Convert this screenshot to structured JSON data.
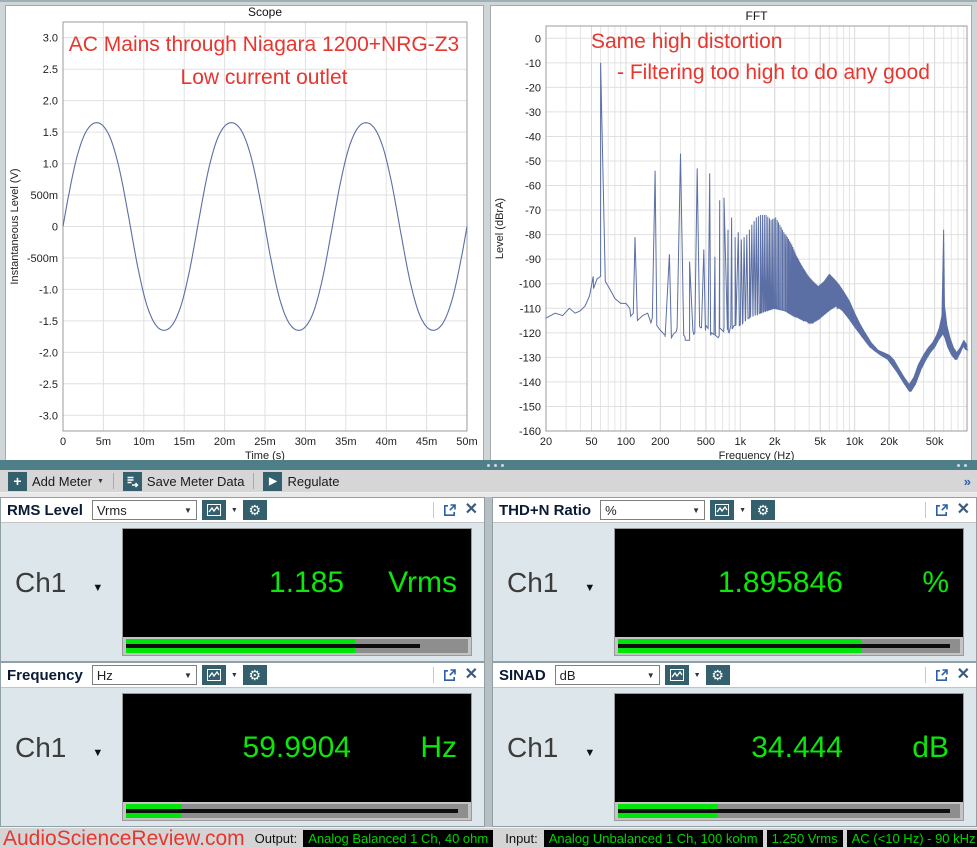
{
  "colors": {
    "accent_teal": "#34606e",
    "splitter_teal": "#4e7e88",
    "trace_blue": "#5b6fa5",
    "annotation_red": "#e8352e",
    "meter_green": "#0ce60c",
    "bar_green": "#00e40c",
    "badge_green": "#00d400",
    "icon_blue": "#2c5eaa"
  },
  "toolbar": {
    "add_meter": "Add Meter",
    "save_meter_data": "Save Meter Data",
    "regulate": "Regulate"
  },
  "meters": [
    {
      "name": "RMS Level",
      "unit_selector": "Vrms",
      "channel": "Ch1",
      "value": "1.185",
      "unit": "Vrms",
      "bar_fill": 0.67,
      "bar_peak": 0.86
    },
    {
      "name": "THD+N Ratio",
      "unit_selector": "%",
      "channel": "Ch1",
      "value": "1.895846",
      "unit": "%",
      "bar_fill": 0.71,
      "bar_peak": 0.97
    },
    {
      "name": "Frequency",
      "unit_selector": "Hz",
      "channel": "Ch1",
      "value": "59.9904",
      "unit": "Hz",
      "bar_fill": 0.16,
      "bar_peak": 0.97
    },
    {
      "name": "SINAD",
      "unit_selector": "dB",
      "channel": "Ch1",
      "value": "34.444",
      "unit": "dB",
      "bar_fill": 0.29,
      "bar_peak": 0.97
    }
  ],
  "status": {
    "watermark": "AudioScienceReview.com",
    "output_label": "Output:",
    "output_value": "Analog Balanced 1 Ch, 40 ohm",
    "input_label": "Input:",
    "input_badges": [
      "Analog Unbalanced 1 Ch, 100 kohm",
      "1.250 Vrms",
      "AC (<10 Hz) - 90 kHz"
    ]
  },
  "chart_data": [
    {
      "type": "line",
      "id": "scope",
      "title": "Scope",
      "xlabel": "Time (s)",
      "ylabel": "Instantaneous Level (V)",
      "xlim": [
        0,
        0.05
      ],
      "ylim": [
        -3.25,
        3.25
      ],
      "grid": true,
      "x_ticks": [
        {
          "v": 0,
          "label": "0"
        },
        {
          "v": 0.005,
          "label": "5m"
        },
        {
          "v": 0.01,
          "label": "10m"
        },
        {
          "v": 0.015,
          "label": "15m"
        },
        {
          "v": 0.02,
          "label": "20m"
        },
        {
          "v": 0.025,
          "label": "25m"
        },
        {
          "v": 0.03,
          "label": "30m"
        },
        {
          "v": 0.035,
          "label": "35m"
        },
        {
          "v": 0.04,
          "label": "40m"
        },
        {
          "v": 0.045,
          "label": "45m"
        },
        {
          "v": 0.05,
          "label": "50m"
        }
      ],
      "y_ticks": [
        {
          "v": 3,
          "label": "3.0"
        },
        {
          "v": 2.5,
          "label": "2.5"
        },
        {
          "v": 2,
          "label": "2.0"
        },
        {
          "v": 1.5,
          "label": "1.5"
        },
        {
          "v": 1,
          "label": "1.0"
        },
        {
          "v": 0.5,
          "label": "500m"
        },
        {
          "v": 0,
          "label": "0"
        },
        {
          "v": -0.5,
          "label": "-500m"
        },
        {
          "v": -1,
          "label": "-1.0"
        },
        {
          "v": -1.5,
          "label": "-1.5"
        },
        {
          "v": -2,
          "label": "-2.0"
        },
        {
          "v": -2.5,
          "label": "-2.5"
        },
        {
          "v": -3,
          "label": "-3.0"
        }
      ],
      "signal": {
        "shape": "ac-mains-sine",
        "frequency_hz": 60,
        "amplitude_v": 1.65,
        "duration_s": 0.05,
        "cycles": 3,
        "flat_top_3rd_harmonic": 0.04
      },
      "annotations": [
        {
          "text": "AC Mains through Niagara 1200+NRG-Z3",
          "x": 258,
          "y": 45,
          "anchor": "middle"
        },
        {
          "text": "Low current outlet",
          "x": 258,
          "y": 78,
          "anchor": "middle"
        }
      ]
    },
    {
      "type": "line",
      "id": "fft",
      "title": "FFT",
      "xlabel": "Frequency (Hz)",
      "ylabel": "Level (dBrA)",
      "xscale": "log",
      "xlim": [
        20,
        96000
      ],
      "ylim": [
        -160,
        5
      ],
      "grid": true,
      "x_ticks": [
        {
          "v": 20,
          "label": "20"
        },
        {
          "v": 50,
          "label": "50"
        },
        {
          "v": 100,
          "label": "100"
        },
        {
          "v": 200,
          "label": "200"
        },
        {
          "v": 500,
          "label": "500"
        },
        {
          "v": 1000,
          "label": "1k"
        },
        {
          "v": 2000,
          "label": "2k"
        },
        {
          "v": 5000,
          "label": "5k"
        },
        {
          "v": 10000,
          "label": "10k"
        },
        {
          "v": 20000,
          "label": "20k"
        },
        {
          "v": 50000,
          "label": "50k"
        }
      ],
      "y_ticks": [
        {
          "v": 0,
          "label": "0"
        },
        {
          "v": -10,
          "label": "-10"
        },
        {
          "v": -20,
          "label": "-20"
        },
        {
          "v": -30,
          "label": "-30"
        },
        {
          "v": -40,
          "label": "-40"
        },
        {
          "v": -50,
          "label": "-50"
        },
        {
          "v": -60,
          "label": "-60"
        },
        {
          "v": -70,
          "label": "-70"
        },
        {
          "v": -80,
          "label": "-80"
        },
        {
          "v": -90,
          "label": "-90"
        },
        {
          "v": -100,
          "label": "-100"
        },
        {
          "v": -110,
          "label": "-110"
        },
        {
          "v": -120,
          "label": "-120"
        },
        {
          "v": -130,
          "label": "-130"
        },
        {
          "v": -140,
          "label": "-140"
        },
        {
          "v": -150,
          "label": "-150"
        },
        {
          "v": -160,
          "label": "-160"
        }
      ],
      "floor": [
        [
          20,
          -114
        ],
        [
          24,
          -112
        ],
        [
          28,
          -113
        ],
        [
          32,
          -110
        ],
        [
          36,
          -112
        ],
        [
          40,
          -111
        ],
        [
          44,
          -109
        ],
        [
          48,
          -105
        ],
        [
          52,
          -102
        ],
        [
          56,
          -98
        ],
        [
          60,
          -97
        ],
        [
          66,
          -99
        ],
        [
          72,
          -102
        ],
        [
          80,
          -106
        ],
        [
          90,
          -108
        ],
        [
          100,
          -108
        ],
        [
          108,
          -110
        ],
        [
          116,
          -112
        ],
        [
          126,
          -115
        ],
        [
          140,
          -113
        ],
        [
          155,
          -112
        ],
        [
          170,
          -114
        ],
        [
          186,
          -117
        ],
        [
          200,
          -119
        ],
        [
          220,
          -121
        ],
        [
          250,
          -122
        ],
        [
          280,
          -118
        ],
        [
          320,
          -121
        ],
        [
          360,
          -123
        ],
        [
          400,
          -120
        ],
        [
          450,
          -118
        ],
        [
          500,
          -117
        ],
        [
          560,
          -120
        ],
        [
          640,
          -122
        ],
        [
          720,
          -118
        ],
        [
          800,
          -120
        ],
        [
          900,
          -117
        ],
        [
          1000,
          -117
        ],
        [
          1200,
          -114
        ],
        [
          1500,
          -112
        ],
        [
          2000,
          -110
        ],
        [
          2500,
          -111
        ],
        [
          3000,
          -113
        ],
        [
          3600,
          -115
        ],
        [
          4200,
          -116
        ],
        [
          5000,
          -114
        ],
        [
          6000,
          -111
        ],
        [
          7000,
          -109
        ],
        [
          8000,
          -111
        ],
        [
          9000,
          -114
        ],
        [
          10000,
          -117
        ],
        [
          12000,
          -122
        ],
        [
          14000,
          -126
        ],
        [
          17000,
          -129
        ],
        [
          20000,
          -131
        ],
        [
          24000,
          -136
        ],
        [
          28000,
          -141
        ],
        [
          31000,
          -144
        ],
        [
          34000,
          -141
        ],
        [
          38000,
          -135
        ],
        [
          42000,
          -131
        ],
        [
          46000,
          -128
        ],
        [
          50000,
          -126
        ],
        [
          54000,
          -123
        ],
        [
          58000,
          -121
        ],
        [
          60000,
          -120
        ],
        [
          63000,
          -122
        ],
        [
          67000,
          -126
        ],
        [
          72000,
          -129
        ],
        [
          78000,
          -131
        ],
        [
          84000,
          -128
        ],
        [
          90000,
          -125
        ],
        [
          96000,
          -127
        ]
      ],
      "harmonics": [
        [
          60,
          -10
        ],
        [
          120,
          -81
        ],
        [
          180,
          -54
        ],
        [
          240,
          -88
        ],
        [
          300,
          -47
        ],
        [
          360,
          -91
        ],
        [
          420,
          -53
        ],
        [
          480,
          -86
        ],
        [
          540,
          -55
        ],
        [
          600,
          -89
        ],
        [
          660,
          -66
        ],
        [
          720,
          -65
        ],
        [
          780,
          -78
        ],
        [
          840,
          -73
        ],
        [
          900,
          -81
        ],
        [
          960,
          -79
        ]
      ],
      "comb": {
        "start": 1020,
        "step": 60,
        "end": 96000,
        "levels": [
          [
            1020,
            -82
          ],
          [
            1140,
            -80
          ],
          [
            1260,
            -76
          ],
          [
            1380,
            -73
          ],
          [
            1500,
            -72
          ],
          [
            1680,
            -72
          ],
          [
            1860,
            -74
          ],
          [
            2040,
            -73
          ],
          [
            2220,
            -76
          ],
          [
            2400,
            -79
          ],
          [
            2580,
            -81
          ],
          [
            2820,
            -84
          ],
          [
            3060,
            -88
          ],
          [
            3300,
            -91
          ],
          [
            3600,
            -94
          ],
          [
            3960,
            -97
          ],
          [
            4320,
            -99
          ],
          [
            4800,
            -101
          ],
          [
            5400,
            -99
          ],
          [
            6000,
            -96
          ],
          [
            6600,
            -98
          ],
          [
            7200,
            -100
          ],
          [
            7980,
            -103
          ],
          [
            9000,
            -107
          ],
          [
            10020,
            -112
          ],
          [
            11040,
            -116
          ],
          [
            12000,
            -119
          ],
          [
            13980,
            -124
          ],
          [
            16020,
            -127
          ],
          [
            18000,
            -128
          ],
          [
            20040,
            -129
          ],
          [
            22020,
            -131
          ],
          [
            24000,
            -134
          ],
          [
            27000,
            -138
          ],
          [
            30000,
            -141
          ],
          [
            33000,
            -138
          ],
          [
            36000,
            -133
          ],
          [
            40020,
            -129
          ],
          [
            44040,
            -126
          ],
          [
            48000,
            -124
          ],
          [
            52020,
            -121
          ],
          [
            55020,
            -118
          ],
          [
            58020,
            -113
          ],
          [
            59940,
            -78
          ],
          [
            61020,
            -109
          ],
          [
            64020,
            -117
          ],
          [
            68040,
            -122
          ],
          [
            73020,
            -126
          ],
          [
            78000,
            -128
          ],
          [
            84000,
            -126
          ],
          [
            90000,
            -123
          ],
          [
            96000,
            -125
          ]
        ]
      },
      "annotations": [
        {
          "text": "Same high distortion",
          "x": 100,
          "y": 42,
          "anchor": "start"
        },
        {
          "text": "- Filtering too high to do any good",
          "x": 126,
          "y": 73,
          "anchor": "start"
        }
      ]
    }
  ]
}
